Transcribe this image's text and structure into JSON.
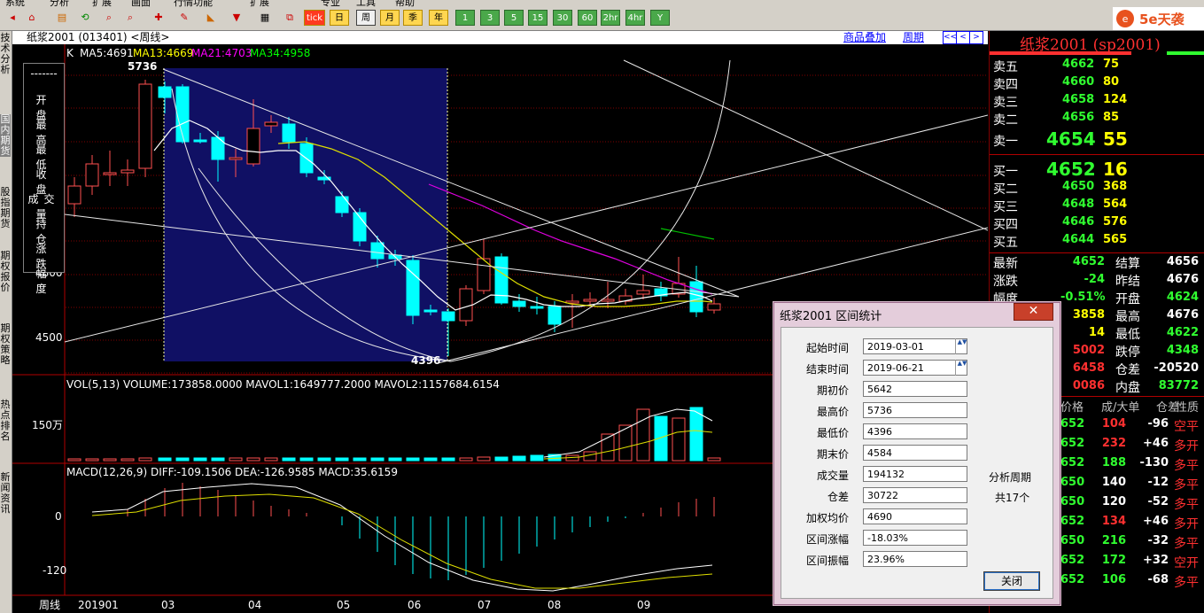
{
  "menu": {
    "items": [
      "系统",
      "分析",
      "扩展",
      "画面",
      "行情功能",
      "扩展",
      "专业",
      "工具",
      "帮助"
    ]
  },
  "toolbar": {
    "period_buttons": [
      "tick",
      "日",
      "周",
      "月",
      "季",
      "年",
      "1",
      "3",
      "5",
      "15",
      "30",
      "60",
      "2hr",
      "4hr",
      "Y"
    ],
    "brand": "5e天袭"
  },
  "left_tabs": [
    "技术分析",
    "国内期货",
    "股指期货",
    "期权报价",
    "期权策略",
    "热点排名",
    "新闻资讯"
  ],
  "chart": {
    "title": "纸浆2001 (013401) <周线>",
    "overlay_link": "商品叠加",
    "period_link": "周期",
    "nav": [
      "<<",
      "<",
      ">",
      ">|"
    ],
    "k_label": "K",
    "ma": [
      {
        "text": "MA5:4691",
        "color": "#ffffff"
      },
      {
        "text": "MA13:4669",
        "color": "#ffff00"
      },
      {
        "text": "MA21:4703",
        "color": "#ff00ff"
      },
      {
        "text": "MA34:4958",
        "color": "#00ff00"
      }
    ],
    "high_mark": "5736",
    "low_mark": "4396",
    "price_ticks": [
      "4800",
      "4500"
    ],
    "vol_title": "VOL(5,13) VOLUME:173858.0000 MAVOL1:1649777.2000 MAVOL2:1157684.6154",
    "vol_tick": "150万",
    "macd_title": "MACD(12,26,9) DIFF:-109.1506 DEA:-126.9585 MACD:35.6159",
    "macd_ticks": [
      "0",
      "-120"
    ],
    "x_labels": [
      "周线",
      "201901",
      "03",
      "04",
      "05",
      "06",
      "07",
      "08",
      "09"
    ],
    "info_labels": [
      "-------",
      "开 盘",
      "最 高",
      "最 低",
      "收 盘",
      "成交量",
      "持 仓",
      "涨 跌",
      "幅 度"
    ]
  },
  "quote_panel": {
    "title": "纸浆2001 (sp2001)",
    "asks": [
      {
        "label": "卖五",
        "price": "4662",
        "vol": "75"
      },
      {
        "label": "卖四",
        "price": "4660",
        "vol": "80"
      },
      {
        "label": "卖三",
        "price": "4658",
        "vol": "124"
      },
      {
        "label": "卖二",
        "price": "4656",
        "vol": "85"
      },
      {
        "label": "卖一",
        "price": "4654",
        "vol": "55"
      }
    ],
    "bids": [
      {
        "label": "买一",
        "price": "4652",
        "vol": "16"
      },
      {
        "label": "买二",
        "price": "4650",
        "vol": "368"
      },
      {
        "label": "买三",
        "price": "4648",
        "vol": "564"
      },
      {
        "label": "买四",
        "price": "4646",
        "vol": "576"
      },
      {
        "label": "买五",
        "price": "4644",
        "vol": "565"
      }
    ],
    "stats_left": [
      {
        "label": "最新",
        "value": "4652"
      },
      {
        "label": "涨跌",
        "value": "-24"
      },
      {
        "label": "幅度",
        "value": "-0.51%"
      },
      {
        "label": "",
        "value": "3858"
      },
      {
        "label": "",
        "value": "14"
      },
      {
        "label": "",
        "value": "5002"
      },
      {
        "label": "",
        "value": "6458"
      },
      {
        "label": "",
        "value": "0086"
      }
    ],
    "stats_right": [
      {
        "label": "结算",
        "value": "4656"
      },
      {
        "label": "昨结",
        "value": "4676"
      },
      {
        "label": "开盘",
        "value": "4624"
      },
      {
        "label": "最高",
        "value": "4676"
      },
      {
        "label": "最低",
        "value": "4622"
      },
      {
        "label": "跌停",
        "value": "4348"
      },
      {
        "label": "仓差",
        "value": "-20520"
      },
      {
        "label": "内盘",
        "value": "83772"
      }
    ],
    "trade_header": [
      "价格",
      "成/大单",
      "仓差",
      "性质"
    ],
    "trades": [
      {
        "p": "652",
        "v": "104",
        "d": "-96",
        "n": "空平"
      },
      {
        "p": "652",
        "v": "232",
        "d": "+46",
        "n": "多开"
      },
      {
        "p": "652",
        "v": "188",
        "d": "-130",
        "n": "多平"
      },
      {
        "p": "650",
        "v": "140",
        "d": "-12",
        "n": "多平"
      },
      {
        "p": "650",
        "v": "120",
        "d": "-52",
        "n": "多平"
      },
      {
        "p": "652",
        "v": "134",
        "d": "+46",
        "n": "多开"
      },
      {
        "p": "650",
        "v": "216",
        "d": "-32",
        "n": "多平"
      },
      {
        "p": "652",
        "v": "172",
        "d": "+32",
        "n": "空开"
      },
      {
        "p": "652",
        "v": "106",
        "d": "-68",
        "n": "多平"
      }
    ]
  },
  "dialog": {
    "title": "纸浆2001 区间统计",
    "close_x": "✕",
    "fields": [
      {
        "label": "起始时间",
        "value": "2019-03-01"
      },
      {
        "label": "结束时间",
        "value": "2019-06-21"
      },
      {
        "label": "期初价",
        "value": "5642"
      },
      {
        "label": "最高价",
        "value": "5736"
      },
      {
        "label": "最低价",
        "value": "4396"
      },
      {
        "label": "期末价",
        "value": "4584"
      },
      {
        "label": "成交量",
        "value": "194132"
      },
      {
        "label": "仓差",
        "value": "30722"
      },
      {
        "label": "加权均价",
        "value": "4690"
      },
      {
        "label": "区间涨幅",
        "value": "-18.03%"
      },
      {
        "label": "区间振幅",
        "value": "23.96%"
      }
    ],
    "analysis_label": "分析周期",
    "analysis_value": "共17个",
    "close_button": "关闭"
  }
}
